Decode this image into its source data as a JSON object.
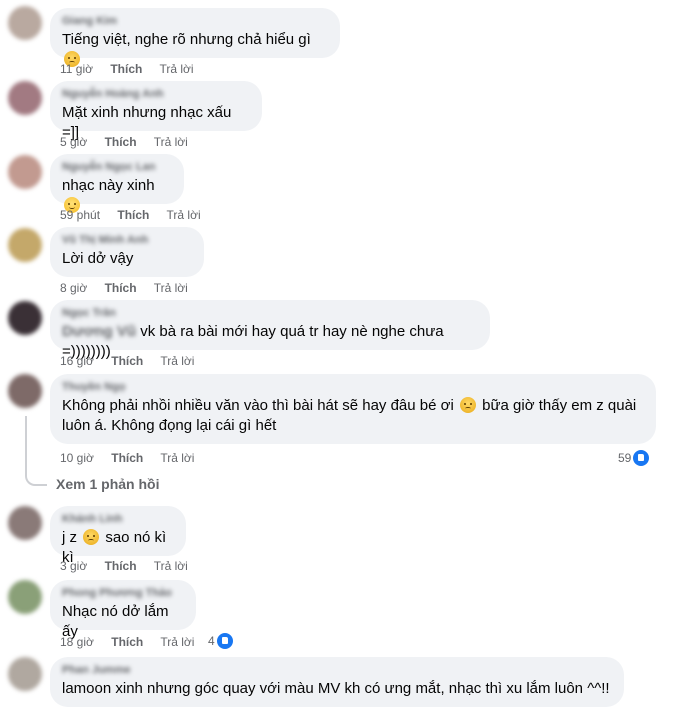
{
  "comments": [
    {
      "author": "Giang Kim",
      "text": "Tiếng việt, nghe rõ nhưng chả hiểu gì",
      "time": "11 giờ",
      "avatar": "#b9a9a0",
      "emoji": "cry"
    },
    {
      "author": "Nguyễn Hoàng Anh",
      "text": "Mặt xinh nhưng nhạc xấu =]]",
      "time": "5 giờ",
      "avatar": "#a27a82"
    },
    {
      "author": "Nguyễn Ngọc Lan",
      "text": "nhạc này xinh",
      "time": "59 phút",
      "avatar": "#c29a90",
      "emoji": "smile"
    },
    {
      "author": "Vũ Thị Minh Anh",
      "text": "Lời dở vậy",
      "time": "8 giờ",
      "avatar": "#c4a86a"
    },
    {
      "author": "Ngọc Trân",
      "mention": "Dương Vũ",
      "text": "vk bà ra bài mới hay quá tr hay nè nghe chưa =))))))))",
      "time": "16 giờ",
      "avatar": "#3a3036"
    },
    {
      "author": "Thuyền Ngọ",
      "text_a": "Không phải nhồi nhiều văn vào thì bài hát sẽ hay đâu bé ơi",
      "text_b": "bữa giờ thấy em z quài",
      "text_c": "luôn á. Không đọng lại cái gì hết",
      "time": "10 giờ",
      "avatar": "#7e6a68",
      "likes": "59",
      "emoji": "cry"
    },
    {
      "author": "Khánh Linh",
      "text_a": "j z",
      "text_b": "sao nó kì kì",
      "time": "3 giờ",
      "avatar": "#8a7a78",
      "emoji": "cry"
    },
    {
      "author": "Phong Phương Thảo",
      "text": "Nhạc nó dở lắm ấy",
      "time": "18 giờ",
      "avatar": "#8aa078",
      "likes": "4"
    },
    {
      "author": "Phan Jumme",
      "text": "lamoon xinh nhưng góc quay với màu MV kh có ưng mắt, nhạc thì xu lắm luôn ^^!!",
      "avatar": "#b0a8a0"
    }
  ],
  "actions": {
    "like": "Thích",
    "reply": "Trả lời"
  },
  "view_replies": "Xem 1 phản hồi"
}
